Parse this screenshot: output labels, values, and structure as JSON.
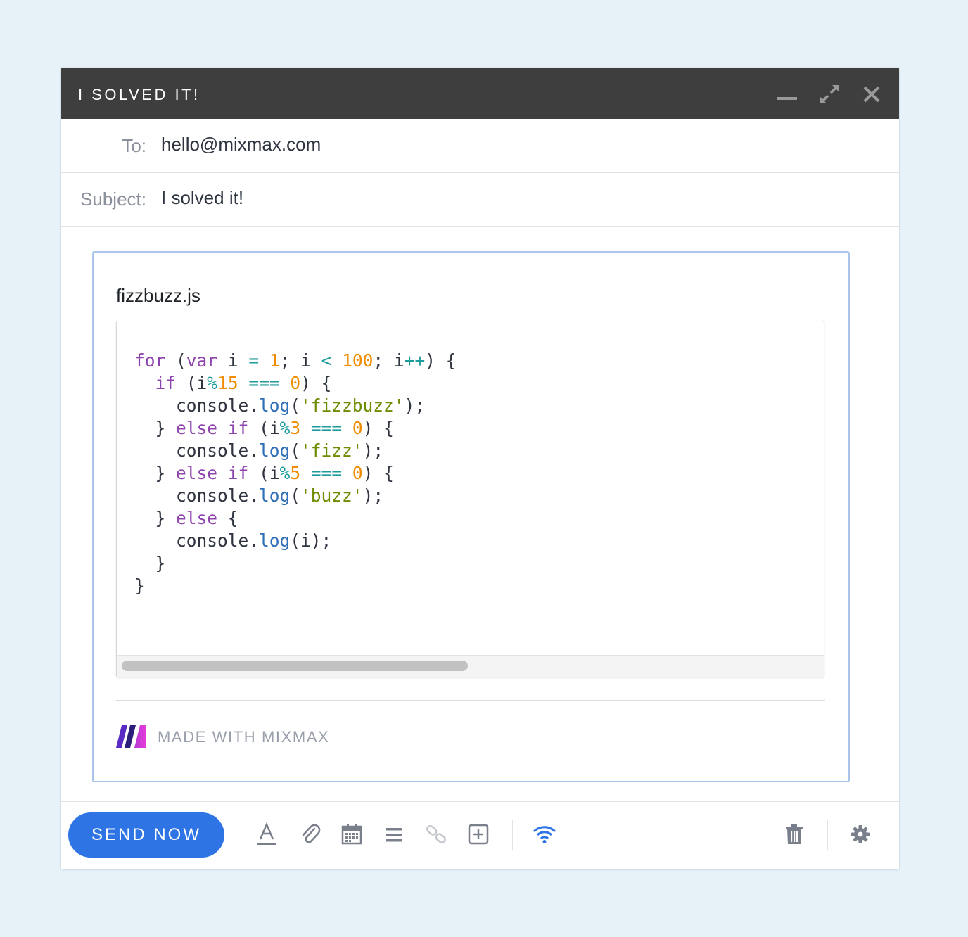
{
  "window": {
    "title": "I SOLVED IT!",
    "controls": [
      "minimize-icon",
      "expand-icon",
      "close-icon"
    ]
  },
  "to": {
    "label": "To:",
    "value": "hello@mixmax.com"
  },
  "subject": {
    "label": "Subject:",
    "value": "I solved it!"
  },
  "snippet": {
    "filename": "fizzbuzz.js",
    "language": "javascript",
    "code": [
      "for (var i = 1; i < 100; i++) {",
      "  if (i%15 === 0) {",
      "    console.log('fizzbuzz');",
      "  } else if (i%3 === 0) {",
      "    console.log('fizz');",
      "  } else if (i%5 === 0) {",
      "    console.log('buzz');",
      "  } else {",
      "    console.log(i);",
      "  }",
      "}"
    ]
  },
  "branding": {
    "text": "MADE WITH MIXMAX",
    "logo": "mixmax-logo"
  },
  "toolbar": {
    "send_label": "SEND NOW",
    "icons": [
      "text-format-icon",
      "attachment-icon",
      "calendar-icon",
      "menu-icon",
      "link-icon",
      "add-icon",
      "tracking-icon",
      "trash-icon",
      "gear-icon"
    ]
  },
  "colors": {
    "titlebar": "#3e3e3e",
    "accent": "#2f74e4",
    "keyword": "#8e44ad",
    "number": "#ef8c00",
    "operator": "#1d9a9a",
    "string": "#6d8c00",
    "function": "#2f6fb7"
  }
}
